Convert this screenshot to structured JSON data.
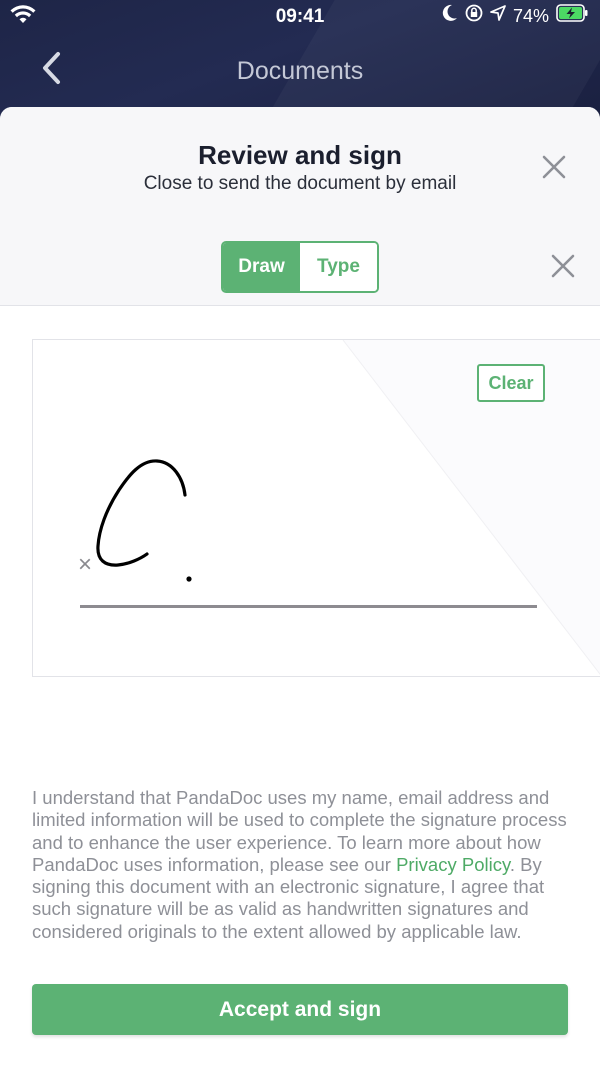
{
  "status_bar": {
    "time": "09:41",
    "battery_percent": "74%"
  },
  "nav": {
    "title": "Documents",
    "back_icon": "chevron-left-icon"
  },
  "dialog": {
    "title": "Review and sign",
    "subtitle": "Close to send the document by email",
    "close_icon": "close-icon"
  },
  "mode_toggle": {
    "options": [
      {
        "label": "Draw",
        "selected": true
      },
      {
        "label": "Type",
        "selected": false
      }
    ],
    "close_icon": "close-icon"
  },
  "signature_pad": {
    "clear_label": "Clear",
    "x_mark": "×"
  },
  "legal": {
    "text_before": "I understand that PandaDoc uses my name, email address and limited information will be used to complete the signature process and to enhance the user experience. To learn more about how PandaDoc uses information, please see our ",
    "link_text": "Privacy Policy",
    "text_after": ". By signing this document with an electronic signature, I agree that such signature will be as valid as handwritten signatures and considered originals to the extent allowed by applicable law."
  },
  "accept_button": {
    "label": "Accept and sign"
  },
  "colors": {
    "accent_green": "#5cb274",
    "header_bg": "#1e2547",
    "sheet_header_bg": "#f7f7f9"
  }
}
